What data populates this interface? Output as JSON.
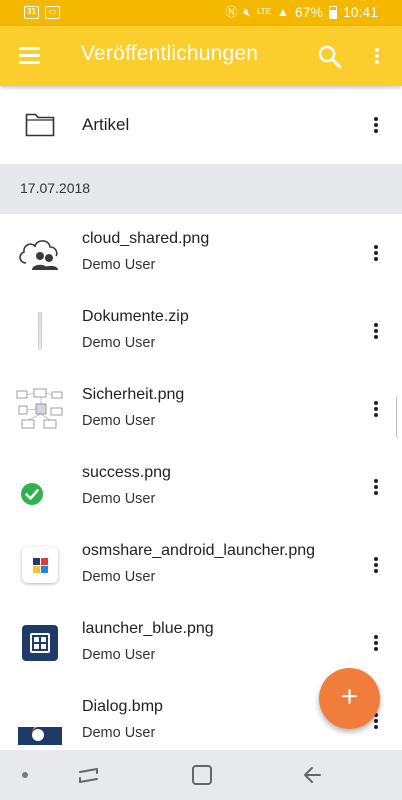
{
  "status_bar": {
    "left_icons": [
      "calendar-icon",
      "gallery-icon"
    ],
    "left_icon_text": [
      "31",
      "▭"
    ],
    "battery": "67%",
    "time": "10:41",
    "network": "LTE"
  },
  "app_bar": {
    "title": "Veröffentlichungen",
    "background": "#fbcd2d"
  },
  "folder": {
    "label": "Artikel"
  },
  "section": {
    "date": "17.07.2018"
  },
  "files": [
    {
      "name": "cloud_shared.png",
      "user": "Demo User",
      "thumb": "cloud-users-icon"
    },
    {
      "name": "Dokumente.zip",
      "user": "Demo User",
      "thumb": "zip-thumbnail"
    },
    {
      "name": "Sicherheit.png",
      "user": "Demo User",
      "thumb": "diagram-thumbnail"
    },
    {
      "name": "success.png",
      "user": "Demo User",
      "thumb": "check-circle-icon"
    },
    {
      "name": "osmshare_android_launcher.png",
      "user": "Demo User",
      "thumb": "app-launcher-icon"
    },
    {
      "name": "launcher_blue.png",
      "user": "Demo User",
      "thumb": "blue-launcher-icon"
    },
    {
      "name": "Dialog.bmp",
      "user": "Demo User",
      "thumb": "dialog-thumbnail"
    }
  ],
  "fab": {
    "label": "+",
    "color": "#f07d3b"
  },
  "colors": {
    "accent": "#fbcd2d",
    "status_bar": "#f4b800",
    "success": "#2eb24b",
    "launcher_blue": "#1e3a66"
  }
}
